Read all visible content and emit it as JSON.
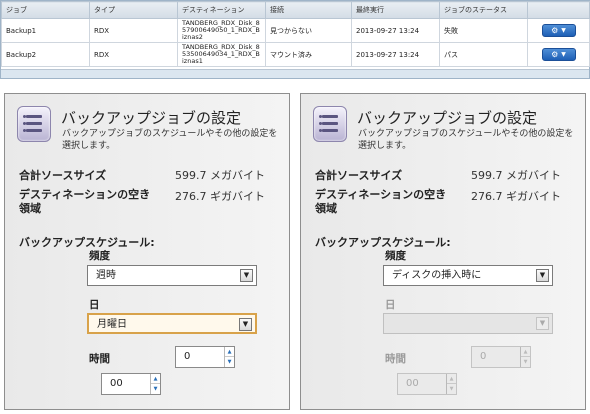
{
  "table": {
    "headers": [
      "ジョブ",
      "タイプ",
      "デスティネーション",
      "接続",
      "最終実行",
      "ジョブのステータス",
      ""
    ],
    "rows": [
      {
        "job": "Backup1",
        "type": "RDX",
        "destination": "TANDBERG_RDX_Disk_857900649050_1_RDX_Biznas2",
        "connection": "見つからない",
        "last_run": "2013-09-27 13:24",
        "status": "失敗"
      },
      {
        "job": "Backup2",
        "type": "RDX",
        "destination": "TANDBERG_RDX_Disk_853500649034_1_RDX_Biznas1",
        "connection": "マウント済み",
        "last_run": "2013-09-27 13:24",
        "status": "パス"
      }
    ],
    "action_icon": "gear-icon",
    "action_caret": "▼"
  },
  "panel_left": {
    "title": "バックアップジョブの設定",
    "description": "バックアップジョブのスケジュールやその他の設定を選択します。",
    "source_size_label": "合計ソースサイズ",
    "source_size_value": "599.7 メガバイト",
    "free_space_label": "デスティネーションの空き領域",
    "free_space_value": "276.7 ギガバイト",
    "schedule_label": "バックアップスケジュール:",
    "frequency_label": "頻度",
    "frequency_value": "週時",
    "day_label": "日",
    "day_value": "月曜日",
    "time_label": "時間",
    "hour_value": "0",
    "minute_value": "00"
  },
  "panel_right": {
    "title": "バックアップジョブの設定",
    "description": "バックアップジョブのスケジュールやその他の設定を選択します。",
    "source_size_label": "合計ソースサイズ",
    "source_size_value": "599.7 メガバイト",
    "free_space_label": "デスティネーションの空き領域",
    "free_space_value": "276.7 ギガバイト",
    "schedule_label": "バックアップスケジュール:",
    "frequency_label": "頻度",
    "frequency_value": "ディスクの挿入時に",
    "day_label": "日",
    "day_value": "",
    "time_label": "時間",
    "hour_value": "0",
    "minute_value": "00"
  },
  "colors": {
    "accent": "#2a6fb8",
    "focus": "#d8a24a",
    "panel_border": "#8e8e8e"
  }
}
